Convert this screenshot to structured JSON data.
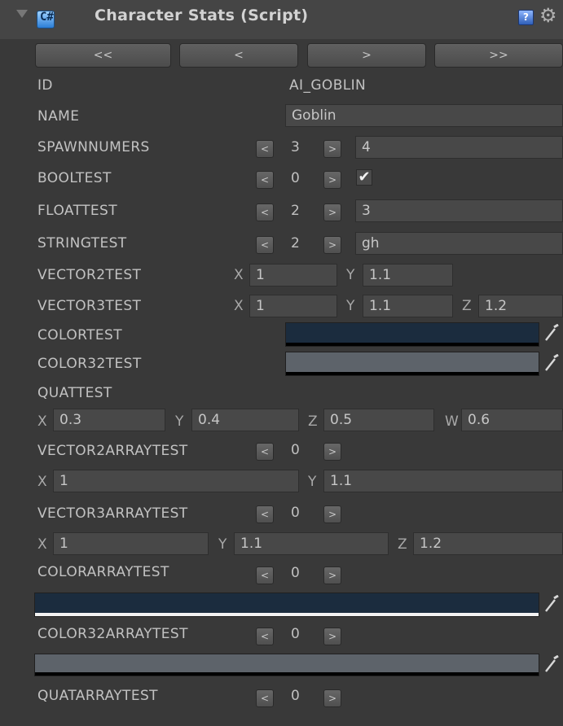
{
  "header": {
    "title": "Character Stats (Script)",
    "script_icon": "csharp-script-icon",
    "help_icon": "help-book-icon",
    "settings_icon": "gear-icon"
  },
  "nav": {
    "first": "<<",
    "prev": "<",
    "next": ">",
    "last": ">>"
  },
  "stepper": {
    "dec": "<",
    "inc": ">"
  },
  "axes": {
    "x": "X",
    "y": "Y",
    "z": "Z",
    "w": "W"
  },
  "fields": {
    "id": {
      "label": "ID",
      "value": "AI_GOBLIN"
    },
    "name": {
      "label": "NAME",
      "value": "Goblin"
    },
    "spawnnumers": {
      "label": "SPAWNNUMERS",
      "index": "3",
      "value": "4"
    },
    "booltest": {
      "label": "BOOLTEST",
      "index": "0",
      "checked": true
    },
    "floattest": {
      "label": "FLOATTEST",
      "index": "2",
      "value": "3"
    },
    "stringtest": {
      "label": "STRINGTEST",
      "index": "2",
      "value": "gh"
    },
    "vector2test": {
      "label": "VECTOR2TEST",
      "x": "1",
      "y": "1.1"
    },
    "vector3test": {
      "label": "VECTOR3TEST",
      "x": "1",
      "y": "1.1",
      "z": "1.2"
    },
    "colortest": {
      "label": "COLORTEST",
      "color": "#1b2c3e"
    },
    "color32test": {
      "label": "COLOR32TEST",
      "color": "#5d636a"
    },
    "quattest": {
      "label": "QUATTEST",
      "x": "0.3",
      "y": "0.4",
      "z": "0.5",
      "w": "0.6"
    },
    "vector2arraytest": {
      "label": "VECTOR2ARRAYTEST",
      "index": "0",
      "x": "1",
      "y": "1.1"
    },
    "vector3arraytest": {
      "label": "VECTOR3ARRAYTEST",
      "index": "0",
      "x": "1",
      "y": "1.1",
      "z": "1.2"
    },
    "colorarraytest": {
      "label": "COLORARRAYTEST",
      "index": "0",
      "color": "#1b2c3e"
    },
    "color32arraytest": {
      "label": "COLOR32ARRAYTEST",
      "index": "0",
      "color": "#5d636a"
    },
    "quatarraytest": {
      "label": "QUATARRAYTEST",
      "index": "0"
    }
  },
  "colors": {
    "panel_bg": "#393939",
    "field_bg": "#484848",
    "header_bg": "#454545"
  },
  "icons": {
    "picker": "eyedropper-icon",
    "check": "checkmark-icon"
  }
}
